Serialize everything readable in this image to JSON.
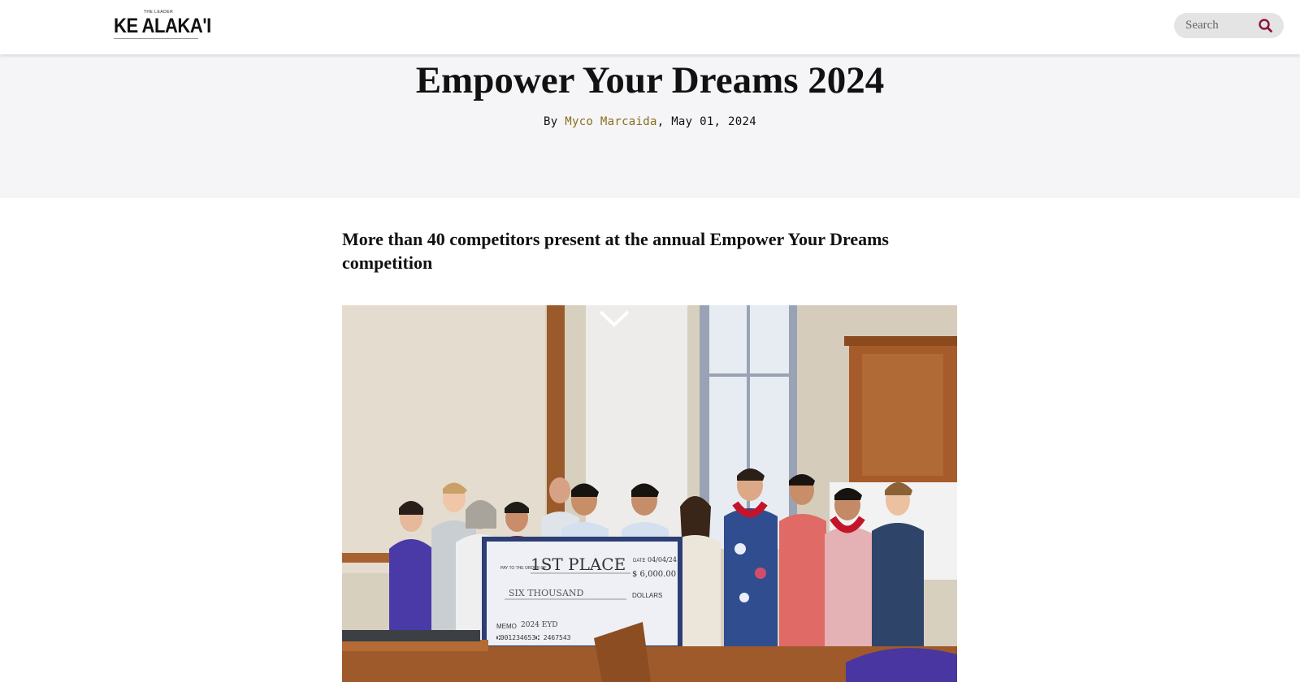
{
  "header": {
    "logo": {
      "kicker": "THE LEADER",
      "wordmark": "KE ALAKA'I"
    },
    "search": {
      "placeholder": "Search",
      "icon": "search-icon"
    }
  },
  "article": {
    "title": "Empower Your Dreams 2024",
    "byline": {
      "prefix": "By ",
      "author": "Myco Marcaida",
      "separator": ", ",
      "date": "May 01, 2024"
    },
    "subtitle": "More than 40 competitors present at the annual Empower Your Dreams competition",
    "photo": {
      "check": {
        "pay_to_label": "PAY TO THE ORDER OF",
        "payee": "1ST PLACE",
        "date_label": "DATE",
        "date": "04/04/24",
        "amount": "$ 6,000.00",
        "amount_words": "SIX THOUSAND",
        "dollars_label": "DOLLARS",
        "memo_label": "MEMO",
        "memo": "2024 EYD",
        "micr": "⑆001234653⑆ 2467543"
      }
    }
  },
  "colors": {
    "author_link": "#8a6d1c",
    "search_icon": "#8b1538",
    "hero_bg": "#f5f5f7"
  }
}
